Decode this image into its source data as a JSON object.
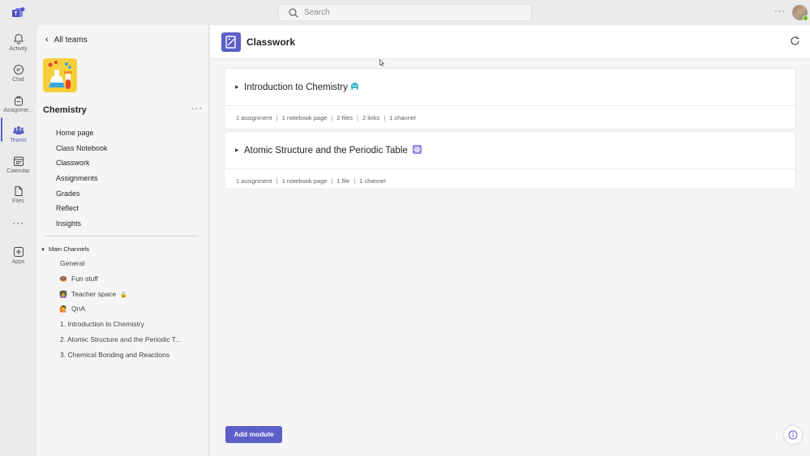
{
  "topbar": {
    "search_placeholder": "Search",
    "more": "···"
  },
  "rail": {
    "items": [
      {
        "label": "Activity",
        "icon": "bell-icon"
      },
      {
        "label": "Chat",
        "icon": "chat-icon"
      },
      {
        "label": "Assignme...",
        "icon": "backpack-icon"
      },
      {
        "label": "Teams",
        "icon": "teams-icon",
        "active": true
      },
      {
        "label": "Calendar",
        "icon": "calendar-icon"
      },
      {
        "label": "Files",
        "icon": "file-icon"
      },
      {
        "label": "Apps",
        "icon": "plus-box-icon"
      }
    ],
    "more": "···"
  },
  "sidebar": {
    "back_label": "All teams",
    "team_name": "Chemistry",
    "team_more": "···",
    "nav": [
      "Home page",
      "Class Notebook",
      "Classwork",
      "Assignments",
      "Grades",
      "Reflect",
      "Insights"
    ],
    "channels_header": "Main Channels",
    "channels": [
      {
        "emoji": "",
        "label": "General"
      },
      {
        "emoji": "🍩",
        "label": "Fun stuff"
      },
      {
        "emoji": "👩‍🏫",
        "label": "Teacher space",
        "locked": true
      },
      {
        "emoji": "🙋",
        "label": "QnA"
      },
      {
        "emoji": "",
        "label": "1. Introduction to Chemistry"
      },
      {
        "emoji": "",
        "label": "2. Atomic Structure and the Periodic T..."
      },
      {
        "emoji": "",
        "label": "3. Chemical Bonding and Reactions"
      }
    ]
  },
  "main": {
    "title": "Classwork",
    "modules": [
      {
        "title": "Introduction to Chemistry",
        "meta": [
          "1 assignment",
          "1 notebook page",
          "2 files",
          "2 links",
          "1 channel"
        ]
      },
      {
        "title": "Atomic Structure and the Periodic Table",
        "meta": [
          "1 assignment",
          "1 notebook page",
          "1 file",
          "1 channel"
        ]
      }
    ],
    "add_module_label": "Add module"
  },
  "colors": {
    "accent": "#5b5fc7",
    "background": "#f5f5f5",
    "rail": "#ebebeb"
  }
}
